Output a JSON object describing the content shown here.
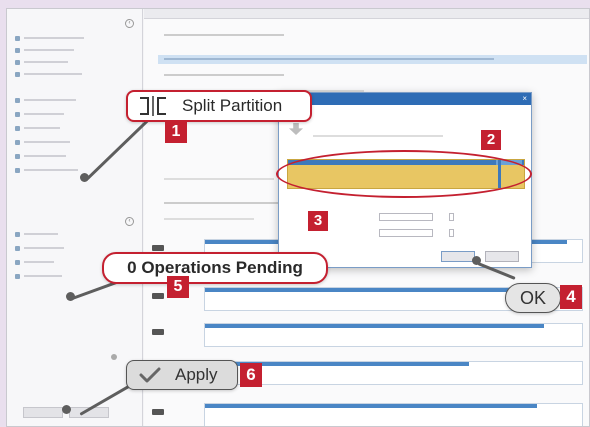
{
  "callouts": {
    "split": {
      "label": "Split Partition",
      "badge": "1"
    },
    "bar": {
      "badge": "2"
    },
    "fields": {
      "badge": "3"
    },
    "ok": {
      "label": "OK",
      "badge": "4"
    },
    "pending": {
      "label": "0 Operations Pending",
      "badge": "5"
    },
    "apply": {
      "label": "Apply",
      "badge": "6"
    }
  },
  "icons": {
    "split": "split-partition-icon",
    "apply": "checkmark-icon"
  },
  "colors": {
    "accent_red": "#c42030",
    "title_blue": "#2e6cb5",
    "partition_yellow": "#e8c663",
    "partition_blue": "#3d79bb"
  }
}
